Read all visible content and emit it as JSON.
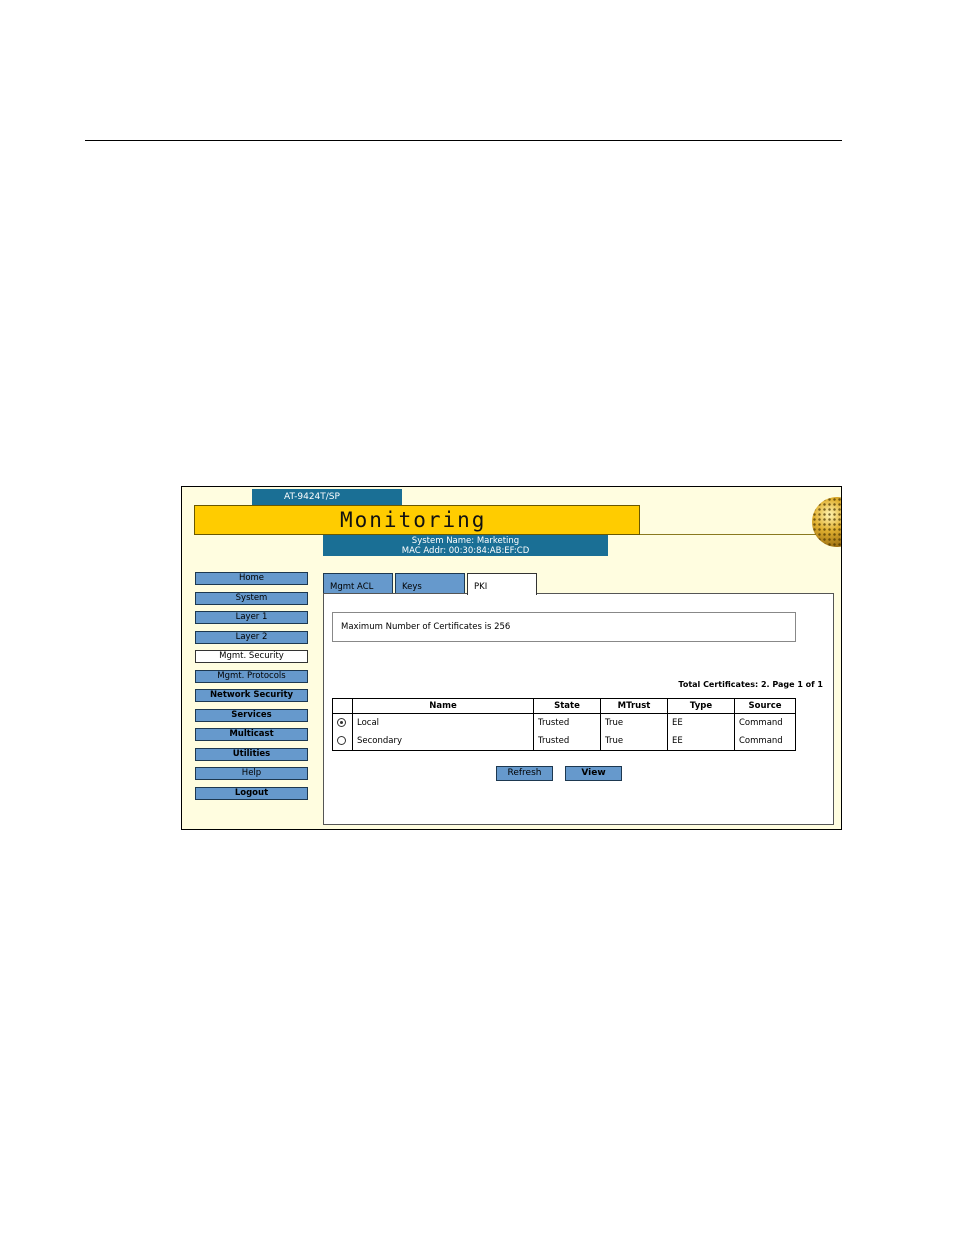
{
  "header": {
    "model": "AT-9424T/SP",
    "title": "Monitoring",
    "system_name": "System Name: Marketing",
    "mac_addr": "MAC Addr: 00:30:84:AB:EF:CD"
  },
  "nav": {
    "items": [
      {
        "label": "Home"
      },
      {
        "label": "System"
      },
      {
        "label": "Layer 1"
      },
      {
        "label": "Layer 2"
      },
      {
        "label": "Mgmt. Security",
        "active": true
      },
      {
        "label": "Mgmt. Protocols"
      },
      {
        "label": "Network Security"
      },
      {
        "label": "Services"
      },
      {
        "label": "Multicast"
      },
      {
        "label": "Utilities"
      },
      {
        "label": "Help"
      },
      {
        "label": "Logout"
      }
    ]
  },
  "tabs": [
    {
      "label": "Mgmt ACL"
    },
    {
      "label": "Keys"
    },
    {
      "label": "PKI",
      "active": true
    }
  ],
  "pki": {
    "max_certificates": "Maximum Number of Certificates is 256",
    "total_certificates": "Total Certificates: 2. Page 1 of 1",
    "columns": [
      "Name",
      "State",
      "MTrust",
      "Type",
      "Source"
    ],
    "rows": [
      {
        "selected": true,
        "name": "Local",
        "state": "Trusted",
        "mtrust": "True",
        "type": "EE",
        "source": "Command"
      },
      {
        "selected": false,
        "name": "Secondary",
        "state": "Trusted",
        "mtrust": "True",
        "type": "EE",
        "source": "Command"
      }
    ],
    "refresh_label": "Refresh",
    "view_label": "View"
  },
  "colors": {
    "banner": "#ffcc00",
    "header_blue": "#1a6f95",
    "button_blue": "#6699cc",
    "panel_bg": "#fffde0"
  }
}
